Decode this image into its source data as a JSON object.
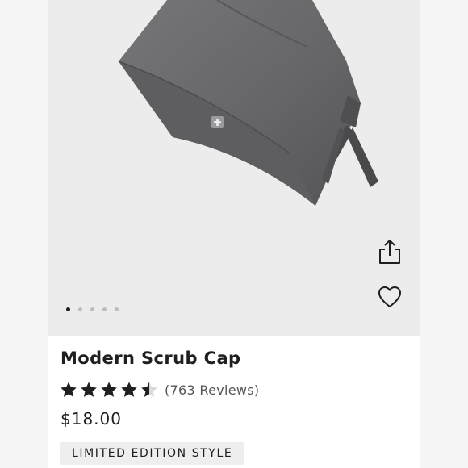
{
  "product": {
    "title": "Modern Scrub Cap",
    "rating_value": 4.5,
    "rating_max": 5,
    "reviews_label": "(763 Reviews)",
    "price": "$18.00",
    "badge": "LIMITED EDITION STYLE"
  },
  "gallery": {
    "image_subject": "charcoal scrub cap",
    "image_count": 5,
    "active_index": 0
  },
  "icons": {
    "share": "share-icon",
    "wishlist": "heart-icon",
    "star": "star-icon"
  },
  "colors": {
    "text": "#1f1f1f",
    "muted": "#555555",
    "gallery_bg": "#ececec",
    "cap_fabric": "#6b6b6d",
    "badge_bg": "#eeeeee"
  }
}
